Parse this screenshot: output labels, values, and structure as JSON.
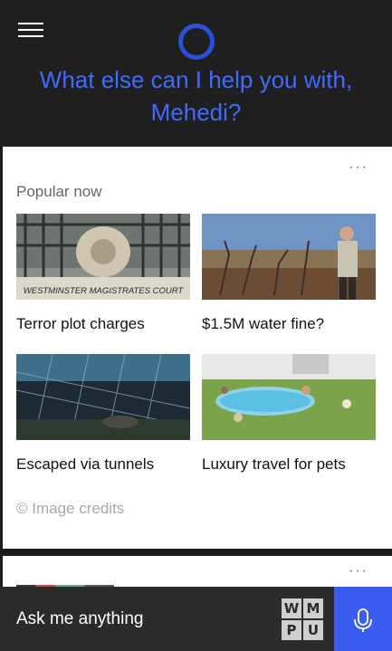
{
  "header": {
    "greeting": "What else can I help you with, Mehedi?"
  },
  "popular_card": {
    "more_label": "···",
    "title": "Popular now",
    "items": [
      {
        "caption": "Terror plot charges",
        "image_text": "WESTMINSTER MAGISTRATES COURT"
      },
      {
        "caption": "$1.5M water fine?"
      },
      {
        "caption": "Escaped via tunnels"
      },
      {
        "caption": "Luxury travel for pets"
      }
    ],
    "credits": "© Image credits"
  },
  "next_card": {
    "more_label": "···"
  },
  "search": {
    "placeholder": "Ask me anything"
  },
  "watermark": {
    "letters": [
      "W",
      "M",
      "P",
      "U"
    ]
  },
  "colors": {
    "accent": "#3f6bff",
    "mic_button": "#3a5cf0",
    "header_bg": "#1f1f1f",
    "searchbar_bg": "#2b2b2b"
  },
  "icons": [
    "menu-icon",
    "cortana-icon",
    "more-icon",
    "microphone-icon"
  ]
}
